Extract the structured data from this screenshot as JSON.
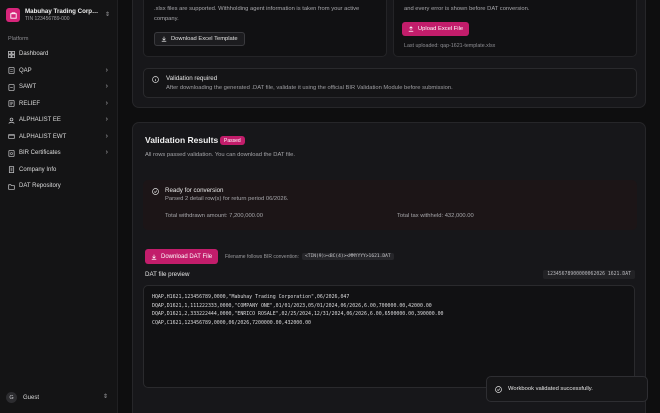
{
  "company": {
    "name": "Mabuhay Trading Corporation",
    "tin": "TIN 123456789-000"
  },
  "sidebar": {
    "section_label": "Platform",
    "items": [
      {
        "label": "Dashboard",
        "icon": "dashboard-icon",
        "has_children": false
      },
      {
        "label": "QAP",
        "icon": "qap-icon",
        "has_children": true
      },
      {
        "label": "SAWT",
        "icon": "sawt-icon",
        "has_children": true
      },
      {
        "label": "RELIEF",
        "icon": "relief-icon",
        "has_children": true
      },
      {
        "label": "ALPHALIST EE",
        "icon": "alphalist-ee-icon",
        "has_children": true
      },
      {
        "label": "ALPHALIST EWT",
        "icon": "alphalist-ewt-icon",
        "has_children": true
      },
      {
        "label": "BIR Certificates",
        "icon": "certificate-icon",
        "has_children": true
      },
      {
        "label": "Company Info",
        "icon": "company-info-icon",
        "has_children": false
      },
      {
        "label": "DAT Repository",
        "icon": "repository-icon",
        "has_children": false
      }
    ],
    "user": {
      "initial": "G",
      "name": "Guest"
    }
  },
  "template_panel": {
    "description": ".xlsx files are supported. Withholding agent information is taken from your active company.",
    "download_label": "Download Excel Template"
  },
  "upload_panel": {
    "description": "and every error is shown before DAT conversion.",
    "upload_label": "Upload Excel File",
    "last_uploaded": "Last uploaded: qap-1621-template.xlsx"
  },
  "validation_required": {
    "title": "Validation required",
    "description": "After downloading the generated .DAT file, validate it using the official BIR Validation Module before submission."
  },
  "validation_results": {
    "title": "Validation Results",
    "badge": "Passed",
    "subtitle": "All rows passed validation. You can download the DAT file.",
    "ready_title": "Ready for conversion",
    "ready_desc": "Parsed 2 detail row(s) for return period 06/2026.",
    "total_withdrawn": "Total withdrawn amount: 7,200,000.00",
    "total_tax": "Total tax withheld: 432,000.00",
    "download_dat_label": "Download DAT File",
    "filename_note": "Filename follows BIR convention:",
    "filename_pattern": "<TIN(9)><BC(4)><MMYYYY>1621.DAT",
    "preview_label": "DAT file preview",
    "preview_filename": "12345678900000062026 1621.DAT",
    "preview_lines": [
      "HQAP,H1621,123456789,0000,\"Mabuhay Trading Corporation\",06/2026,047",
      "DQAP,D1621,1,111222333,0000,\"COMPANY ONE\",01/01/2023,05/01/2024,06/2026,6.00,700000.00,42000.00",
      "DQAP,D1621,2,333222444,0000,\"ENRICO ROSALE\",02/25/2024,12/31/2024,06/2026,6.00,6500000.00,390000.00",
      "CQAP,C1621,123456789,0000,06/2026,7200000.00,432000.00"
    ]
  },
  "toast": {
    "message": "Workbook validated successfully."
  },
  "colors": {
    "accent": "#c21d6b",
    "background": "#0e0e0f",
    "card": "#17171a"
  }
}
